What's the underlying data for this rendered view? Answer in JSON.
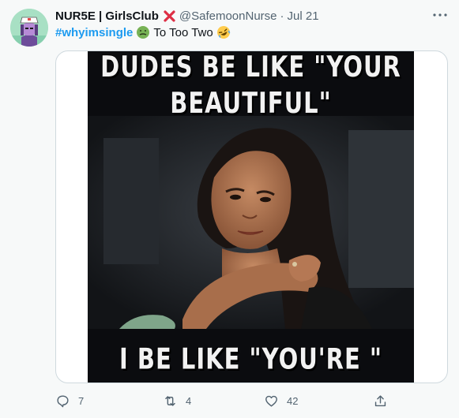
{
  "tweet": {
    "author": {
      "display_name": "NUR5E | GirlsClub",
      "handle": "@SafemoonNurse",
      "separator": "·",
      "time": "Jul 21"
    },
    "text": {
      "hashtag": "#whyimsingle",
      "body": "To Too Two"
    },
    "meme": {
      "top_text_line1": "DUDES BE LIKE \"YOUR",
      "top_text_line2": "BEAUTIFUL\"",
      "bottom_text": "I BE LIKE \"YOU'RE \""
    },
    "actions": {
      "replies": "7",
      "retweets": "4",
      "likes": "42"
    }
  },
  "colors": {
    "link": "#1d9bf0",
    "muted": "#536471",
    "background": "#f7f9f9"
  },
  "icons": [
    "avatar",
    "cross-mark-icon",
    "more-icon",
    "nauseated-face-emoji",
    "rofl-emoji",
    "reply-icon",
    "retweet-icon",
    "like-icon",
    "share-icon"
  ]
}
